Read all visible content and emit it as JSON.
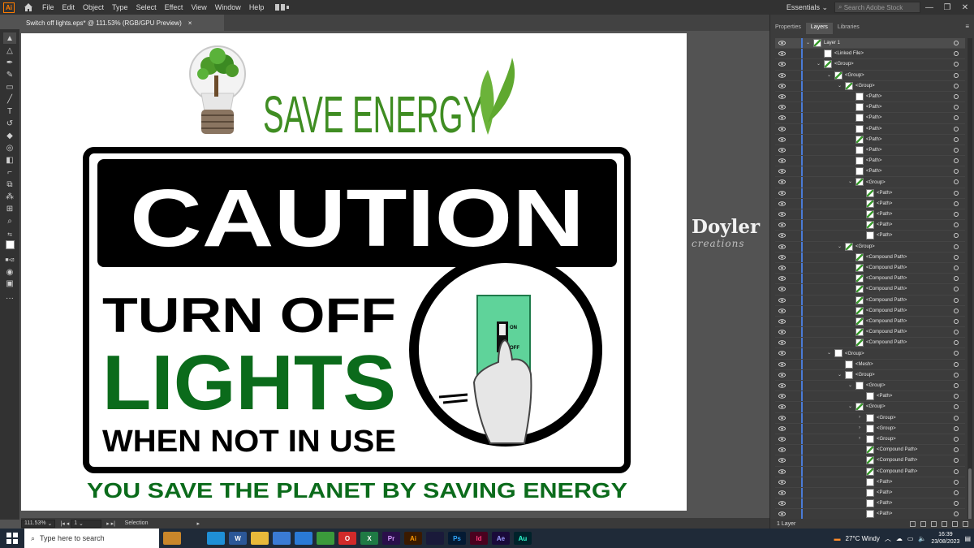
{
  "app": {
    "logo": "Ai",
    "menu": [
      "File",
      "Edit",
      "Object",
      "Type",
      "Select",
      "Effect",
      "View",
      "Window",
      "Help"
    ],
    "workspace": "Essentials",
    "stock_search_placeholder": "Search Adobe Stock"
  },
  "document": {
    "tab_title": "Switch off lights.eps* @ 111.53% (RGB/GPU Preview)",
    "close": "×"
  },
  "artwork": {
    "headline": "SAVE ENERGY",
    "caution": "CAUTION",
    "line1": "TURN OFF",
    "line2": "LIGHTS",
    "line3": "WHEN NOT IN USE",
    "switch_on": "ON",
    "switch_off": "OFF",
    "tagline": "YOU SAVE THE PLANET BY SAVING ENERGY",
    "green": "#0b6b1b",
    "switch_green": "#5fd39a"
  },
  "watermark": {
    "name": "Doyler",
    "sub": "creations"
  },
  "status": {
    "zoom": "111.53%",
    "artboard": "1",
    "tool": "Selection"
  },
  "panel": {
    "tabs": [
      "Properties",
      "Layers",
      "Libraries"
    ],
    "active_tab": "Layers",
    "footer": "1 Layer",
    "layers": [
      {
        "name": "Layer 1",
        "indent": 0,
        "arrow": "v",
        "thumb": "green",
        "top": true
      },
      {
        "name": "<Linked File>",
        "indent": 1,
        "arrow": "",
        "thumb": "white"
      },
      {
        "name": "<Group>",
        "indent": 1,
        "arrow": "v",
        "thumb": "green"
      },
      {
        "name": "<Group>",
        "indent": 2,
        "arrow": "v",
        "thumb": "green"
      },
      {
        "name": "<Group>",
        "indent": 3,
        "arrow": "v",
        "thumb": "green"
      },
      {
        "name": "<Path>",
        "indent": 4,
        "arrow": "",
        "thumb": "white"
      },
      {
        "name": "<Path>",
        "indent": 4,
        "arrow": "",
        "thumb": "white"
      },
      {
        "name": "<Path>",
        "indent": 4,
        "arrow": "",
        "thumb": "white"
      },
      {
        "name": "<Path>",
        "indent": 4,
        "arrow": "",
        "thumb": "white"
      },
      {
        "name": "<Path>",
        "indent": 4,
        "arrow": "",
        "thumb": "green"
      },
      {
        "name": "<Path>",
        "indent": 4,
        "arrow": "",
        "thumb": "white"
      },
      {
        "name": "<Path>",
        "indent": 4,
        "arrow": "",
        "thumb": "white"
      },
      {
        "name": "<Path>",
        "indent": 4,
        "arrow": "",
        "thumb": "white"
      },
      {
        "name": "<Group>",
        "indent": 4,
        "arrow": "v",
        "thumb": "green"
      },
      {
        "name": "<Path>",
        "indent": 5,
        "arrow": "",
        "thumb": "green"
      },
      {
        "name": "<Path>",
        "indent": 5,
        "arrow": "",
        "thumb": "green"
      },
      {
        "name": "<Path>",
        "indent": 5,
        "arrow": "",
        "thumb": "green"
      },
      {
        "name": "<Path>",
        "indent": 5,
        "arrow": "",
        "thumb": "green"
      },
      {
        "name": "<Path>",
        "indent": 5,
        "arrow": "",
        "thumb": "white"
      },
      {
        "name": "<Group>",
        "indent": 3,
        "arrow": "v",
        "thumb": "green"
      },
      {
        "name": "<Compound Path>",
        "indent": 4,
        "arrow": "",
        "thumb": "green"
      },
      {
        "name": "<Compound Path>",
        "indent": 4,
        "arrow": "",
        "thumb": "green"
      },
      {
        "name": "<Compound Path>",
        "indent": 4,
        "arrow": "",
        "thumb": "green"
      },
      {
        "name": "<Compound Path>",
        "indent": 4,
        "arrow": "",
        "thumb": "green"
      },
      {
        "name": "<Compound Path>",
        "indent": 4,
        "arrow": "",
        "thumb": "green"
      },
      {
        "name": "<Compound Path>",
        "indent": 4,
        "arrow": "",
        "thumb": "green"
      },
      {
        "name": "<Compound Path>",
        "indent": 4,
        "arrow": "",
        "thumb": "green"
      },
      {
        "name": "<Compound Path>",
        "indent": 4,
        "arrow": "",
        "thumb": "green"
      },
      {
        "name": "<Compound Path>",
        "indent": 4,
        "arrow": "",
        "thumb": "green"
      },
      {
        "name": "<Group>",
        "indent": 2,
        "arrow": "v",
        "thumb": "white"
      },
      {
        "name": "<Mesh>",
        "indent": 3,
        "arrow": "",
        "thumb": "white"
      },
      {
        "name": "<Group>",
        "indent": 3,
        "arrow": "v",
        "thumb": "white"
      },
      {
        "name": "<Group>",
        "indent": 4,
        "arrow": "v",
        "thumb": "white"
      },
      {
        "name": "<Path>",
        "indent": 5,
        "arrow": "",
        "thumb": "white"
      },
      {
        "name": "<Group>",
        "indent": 4,
        "arrow": "v",
        "thumb": "green"
      },
      {
        "name": "<Group>",
        "indent": 5,
        "arrow": ">",
        "thumb": "white"
      },
      {
        "name": "<Group>",
        "indent": 5,
        "arrow": ">",
        "thumb": "white"
      },
      {
        "name": "<Group>",
        "indent": 5,
        "arrow": ">",
        "thumb": "white"
      },
      {
        "name": "<Compound Path>",
        "indent": 5,
        "arrow": "",
        "thumb": "green"
      },
      {
        "name": "<Compound Path>",
        "indent": 5,
        "arrow": "",
        "thumb": "green"
      },
      {
        "name": "<Compound Path>",
        "indent": 5,
        "arrow": "",
        "thumb": "green"
      },
      {
        "name": "<Path>",
        "indent": 5,
        "arrow": "",
        "thumb": "white"
      },
      {
        "name": "<Path>",
        "indent": 5,
        "arrow": "",
        "thumb": "white"
      },
      {
        "name": "<Path>",
        "indent": 5,
        "arrow": "",
        "thumb": "white"
      },
      {
        "name": "<Path>",
        "indent": 5,
        "arrow": "",
        "thumb": "white"
      }
    ]
  },
  "taskbar": {
    "search_placeholder": "Type here to search",
    "apps": [
      {
        "icon": "briefcase-icon",
        "label": "",
        "bg": "#c9862a",
        "fg": "#fff"
      },
      {
        "icon": "task-view-icon",
        "label": "",
        "bg": "transparent",
        "fg": "#fff"
      },
      {
        "icon": "edge-icon",
        "label": "",
        "bg": "#1f8fd6",
        "fg": "#fff"
      },
      {
        "icon": "word-icon",
        "label": "W",
        "bg": "#2b5797",
        "fg": "#fff"
      },
      {
        "icon": "file-explorer-icon",
        "label": "",
        "bg": "#e8b93a",
        "fg": "#fff"
      },
      {
        "icon": "store-icon",
        "label": "",
        "bg": "#3a7bd5",
        "fg": "#fff"
      },
      {
        "icon": "mail-icon",
        "label": "",
        "bg": "#2a7ad6",
        "fg": "#fff"
      },
      {
        "icon": "chrome-icon",
        "label": "",
        "bg": "#3b9a3b",
        "fg": "#fff"
      },
      {
        "icon": "opera-icon",
        "label": "O",
        "bg": "#d12a2a",
        "fg": "#fff"
      },
      {
        "icon": "excel-icon",
        "label": "X",
        "bg": "#1f7a44",
        "fg": "#fff"
      },
      {
        "icon": "premiere-icon",
        "label": "Pr",
        "bg": "#2a0f4a",
        "fg": "#d79cff"
      },
      {
        "icon": "illustrator-icon",
        "label": "Ai",
        "bg": "#3a1a00",
        "fg": "#ff9a00"
      },
      {
        "icon": "media-encoder-icon",
        "label": "",
        "bg": "#1a1a3a",
        "fg": "#8fa0ff"
      },
      {
        "icon": "photoshop-icon",
        "label": "Ps",
        "bg": "#041a33",
        "fg": "#31a8ff"
      },
      {
        "icon": "indesign-icon",
        "label": "Id",
        "bg": "#49021f",
        "fg": "#ff3a7a"
      },
      {
        "icon": "after-effects-icon",
        "label": "Ae",
        "bg": "#1a0a3a",
        "fg": "#9b9bff"
      },
      {
        "icon": "audition-icon",
        "label": "Au",
        "bg": "#00222a",
        "fg": "#2effd0"
      }
    ],
    "weather": "27°C  Windy",
    "time": "16:39",
    "date": "23/08/2023"
  }
}
